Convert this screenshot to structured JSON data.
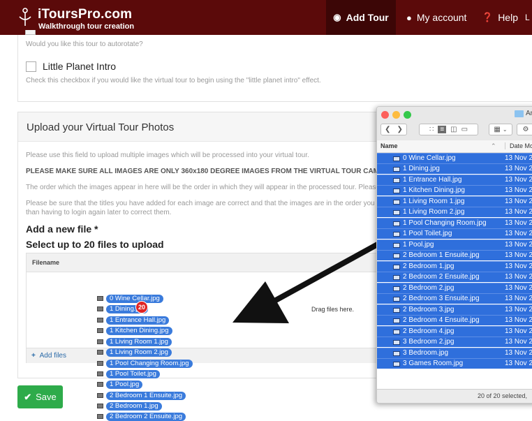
{
  "header": {
    "logo_title": "iToursPro.com",
    "logo_subtitle": "Walkthrough tour creation",
    "nav": [
      {
        "label": "Add Tour",
        "icon": "camera-icon"
      },
      {
        "label": "My account",
        "icon": "user-icon"
      },
      {
        "label": "Help",
        "icon": "question-circle-icon"
      }
    ],
    "nav_extra": "L"
  },
  "options": {
    "autorotate_hint": "Would you like this tour to autorotate?",
    "little_planet_label": "Little Planet Intro",
    "little_planet_hint": "Check this checkbox if you would like the virtual tour to begin using the \"little planet intro\" effect."
  },
  "upload": {
    "title": "Upload your Virtual Tour Photos",
    "paragraphs": [
      "Please use this field to upload multiple images which will be processed into your virtual tour.",
      "PLEASE MAKE SURE ALL IMAGES ARE ONLY 360x180 DEGREE IMAGES FROM THE VIRTUAL TOUR CAMERA.",
      "The order which the images appear in here will be the order in which they will appear in the processed tour. Please",
      "Please be sure that the titles you have added for each image are correct and that the images are in the order you w",
      "than having to login again later to correct them."
    ],
    "add_new_file": "Add a new file *",
    "select_up_to": "Select up to 20 files to upload",
    "column_filename": "Filename",
    "drop_hint": "Drag files here.",
    "add_files": "Add files",
    "save_label": "Save"
  },
  "drag": {
    "badge_count": "20",
    "files": [
      "0 Wine Cellar.jpg",
      "1 Dining.jpg",
      "1 Entrance Hall.jpg",
      "1 Kitchen Dining.jpg",
      "1 Living Room 1.jpg",
      "1 Living Room 2.jpg",
      "1 Pool Changing Room.jpg",
      "1 Pool Toilet.jpg",
      "1 Pool.jpg",
      "2 Bedroom 1 Ensuite.jpg",
      "2 Bedroom 1.jpg",
      "2 Bedroom 2 Ensuite.jpg"
    ]
  },
  "finder": {
    "folder_name": "Ar",
    "column_name": "Name",
    "column_date": "Date Mod",
    "status": "20 of 20 selected,",
    "rows": [
      {
        "name": "0 Wine Cellar.jpg",
        "date": "13 Nov 2"
      },
      {
        "name": "1 Dining.jpg",
        "date": "13 Nov 2"
      },
      {
        "name": "1 Entrance Hall.jpg",
        "date": "13 Nov 2"
      },
      {
        "name": "1 Kitchen Dining.jpg",
        "date": "13 Nov 2"
      },
      {
        "name": "1 Living Room 1.jpg",
        "date": "13 Nov 2"
      },
      {
        "name": "1 Living Room 2.jpg",
        "date": "13 Nov 2"
      },
      {
        "name": "1 Pool Changing Room.jpg",
        "date": "13 Nov 2"
      },
      {
        "name": "1 Pool Toilet.jpg",
        "date": "13 Nov 2"
      },
      {
        "name": "1 Pool.jpg",
        "date": "13 Nov 2"
      },
      {
        "name": "2 Bedroom 1 Ensuite.jpg",
        "date": "13 Nov 2"
      },
      {
        "name": "2 Bedroom 1.jpg",
        "date": "13 Nov 2"
      },
      {
        "name": "2 Bedroom 2 Ensuite.jpg",
        "date": "13 Nov 2"
      },
      {
        "name": "2 Bedroom 2.jpg",
        "date": "13 Nov 2"
      },
      {
        "name": "2 Bedroom 3 Ensuite.jpg",
        "date": "13 Nov 2"
      },
      {
        "name": "2 Bedroom 3.jpg",
        "date": "13 Nov 2"
      },
      {
        "name": "2 Bedroom 4 Ensuite.jpg",
        "date": "13 Nov 2"
      },
      {
        "name": "2 Bedroom 4.jpg",
        "date": "13 Nov 2"
      },
      {
        "name": "3 Bedroom 2.jpg",
        "date": "13 Nov 2"
      },
      {
        "name": "3 Bedroom.jpg",
        "date": "13 Nov 2"
      },
      {
        "name": "3 Games Room.jpg",
        "date": "13 Nov 2"
      }
    ]
  },
  "colors": {
    "header_bg": "#5b0a0a",
    "nav_active_bg": "#3c0606",
    "save_green": "#2eab4a",
    "selection_blue": "#2f6fdc",
    "drag_label_blue": "#3a7bdc",
    "badge_red": "#e02424"
  }
}
